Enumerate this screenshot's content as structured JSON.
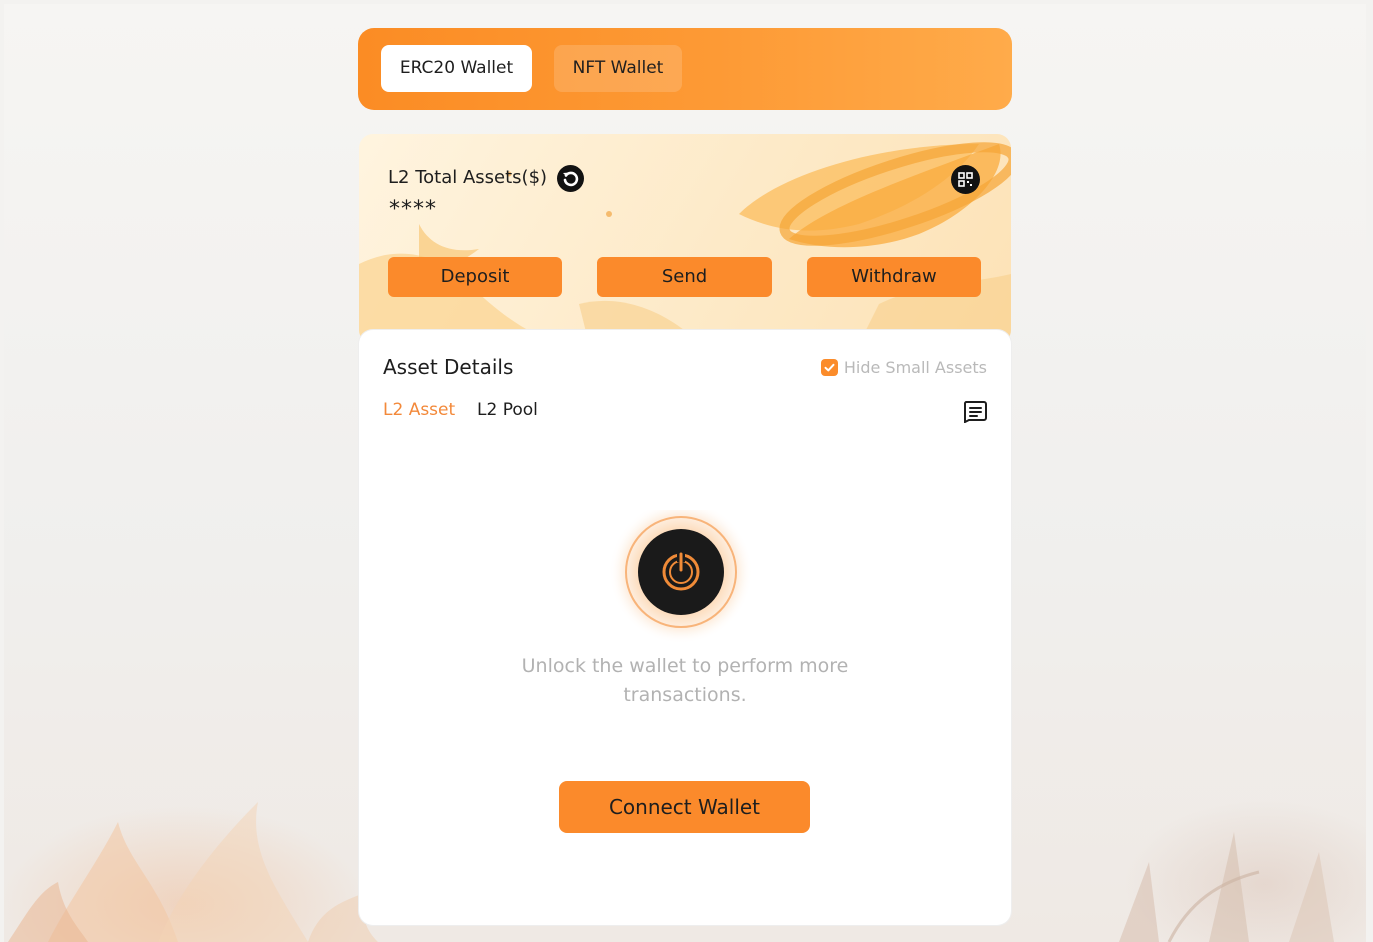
{
  "wallet_tabs": {
    "erc20": "ERC20 Wallet",
    "nft": "NFT Wallet",
    "active": "ERC20 Wallet"
  },
  "summary": {
    "total_label": "L2 Total Assets($)",
    "masked_value": "****",
    "refresh_icon": "refresh-icon",
    "qr_icon": "qr-code-icon",
    "actions": {
      "deposit": "Deposit",
      "send": "Send",
      "withdraw": "Withdraw"
    }
  },
  "details": {
    "title": "Asset Details",
    "hide_small_label": "Hide Small Assets",
    "hide_small_checked": true,
    "tabs": {
      "l2_asset": "L2 Asset",
      "l2_pool": "L2 Pool",
      "active": "L2 Asset"
    },
    "list_icon": "list-view-icon",
    "lock_icon": "lock-icon",
    "empty_message": "Unlock the wallet to perform more transactions.",
    "connect_label": "Connect Wallet"
  },
  "colors": {
    "accent": "#fb8a2b",
    "active_tab_text": "#f3893a",
    "muted_text": "#b2b2b2",
    "dark": "#121212"
  }
}
